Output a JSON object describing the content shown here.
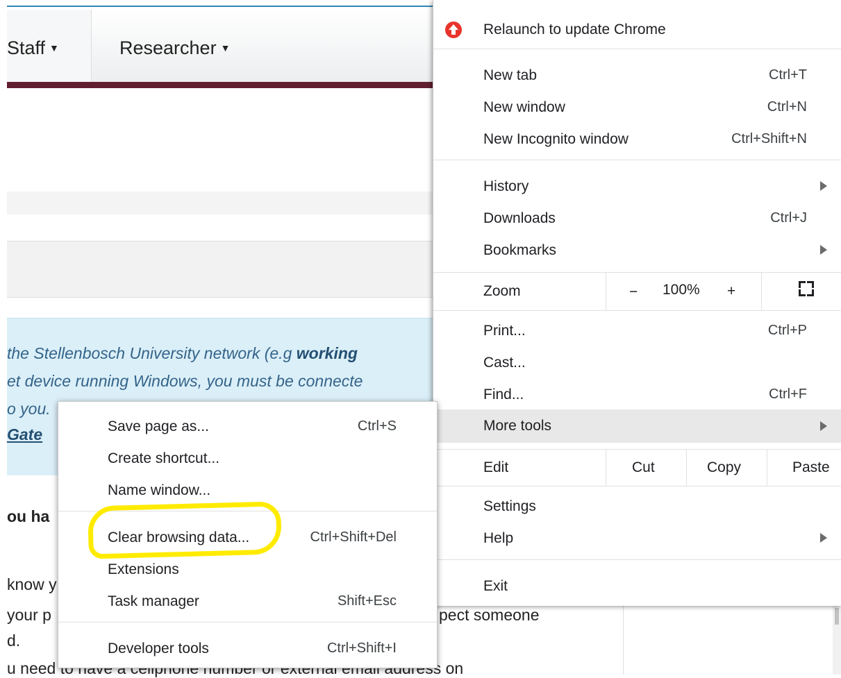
{
  "page": {
    "nav": {
      "items": [
        "Staff",
        "Researcher"
      ]
    },
    "info": {
      "line1_pre": "the Stellenbosch University network (e.g ",
      "line1_bold": "working",
      "line2": "et device running Windows, you must be connecte",
      "line3": "o you.",
      "line4_link": "Gate"
    },
    "body": {
      "heading_fragment": "ou ha",
      "line1": "know y",
      "line2": "your p",
      "line2_right": "pect someone",
      "line3": "d.",
      "line4": "u need to have a cellphone number or external email address on"
    }
  },
  "menu": {
    "update": "Relaunch to update Chrome",
    "new_tab": {
      "label": "New tab",
      "shortcut": "Ctrl+T"
    },
    "new_window": {
      "label": "New window",
      "shortcut": "Ctrl+N"
    },
    "incognito": {
      "label": "New Incognito window",
      "shortcut": "Ctrl+Shift+N"
    },
    "history": {
      "label": "History"
    },
    "downloads": {
      "label": "Downloads",
      "shortcut": "Ctrl+J"
    },
    "bookmarks": {
      "label": "Bookmarks"
    },
    "zoom": {
      "label": "Zoom",
      "minus": "−",
      "value": "100%",
      "plus": "+"
    },
    "print": {
      "label": "Print...",
      "shortcut": "Ctrl+P"
    },
    "cast": {
      "label": "Cast..."
    },
    "find": {
      "label": "Find...",
      "shortcut": "Ctrl+F"
    },
    "more_tools": {
      "label": "More tools"
    },
    "edit": {
      "label": "Edit",
      "cut": "Cut",
      "copy": "Copy",
      "paste": "Paste"
    },
    "settings": {
      "label": "Settings"
    },
    "help": {
      "label": "Help"
    },
    "exit": {
      "label": "Exit"
    }
  },
  "submenu": {
    "save_page": {
      "label": "Save page as...",
      "shortcut": "Ctrl+S"
    },
    "create_shortcut": {
      "label": "Create shortcut..."
    },
    "name_window": {
      "label": "Name window..."
    },
    "clear_data": {
      "label": "Clear browsing data...",
      "shortcut": "Ctrl+Shift+Del"
    },
    "extensions": {
      "label": "Extensions"
    },
    "task_manager": {
      "label": "Task manager",
      "shortcut": "Shift+Esc"
    },
    "dev_tools": {
      "label": "Developer tools",
      "shortcut": "Ctrl+Shift+I"
    }
  },
  "colors": {
    "nav_bar": "#611e2e",
    "info_bg": "#dbeff8",
    "highlight": "#ffeb00",
    "update_icon": "#e8352c"
  }
}
